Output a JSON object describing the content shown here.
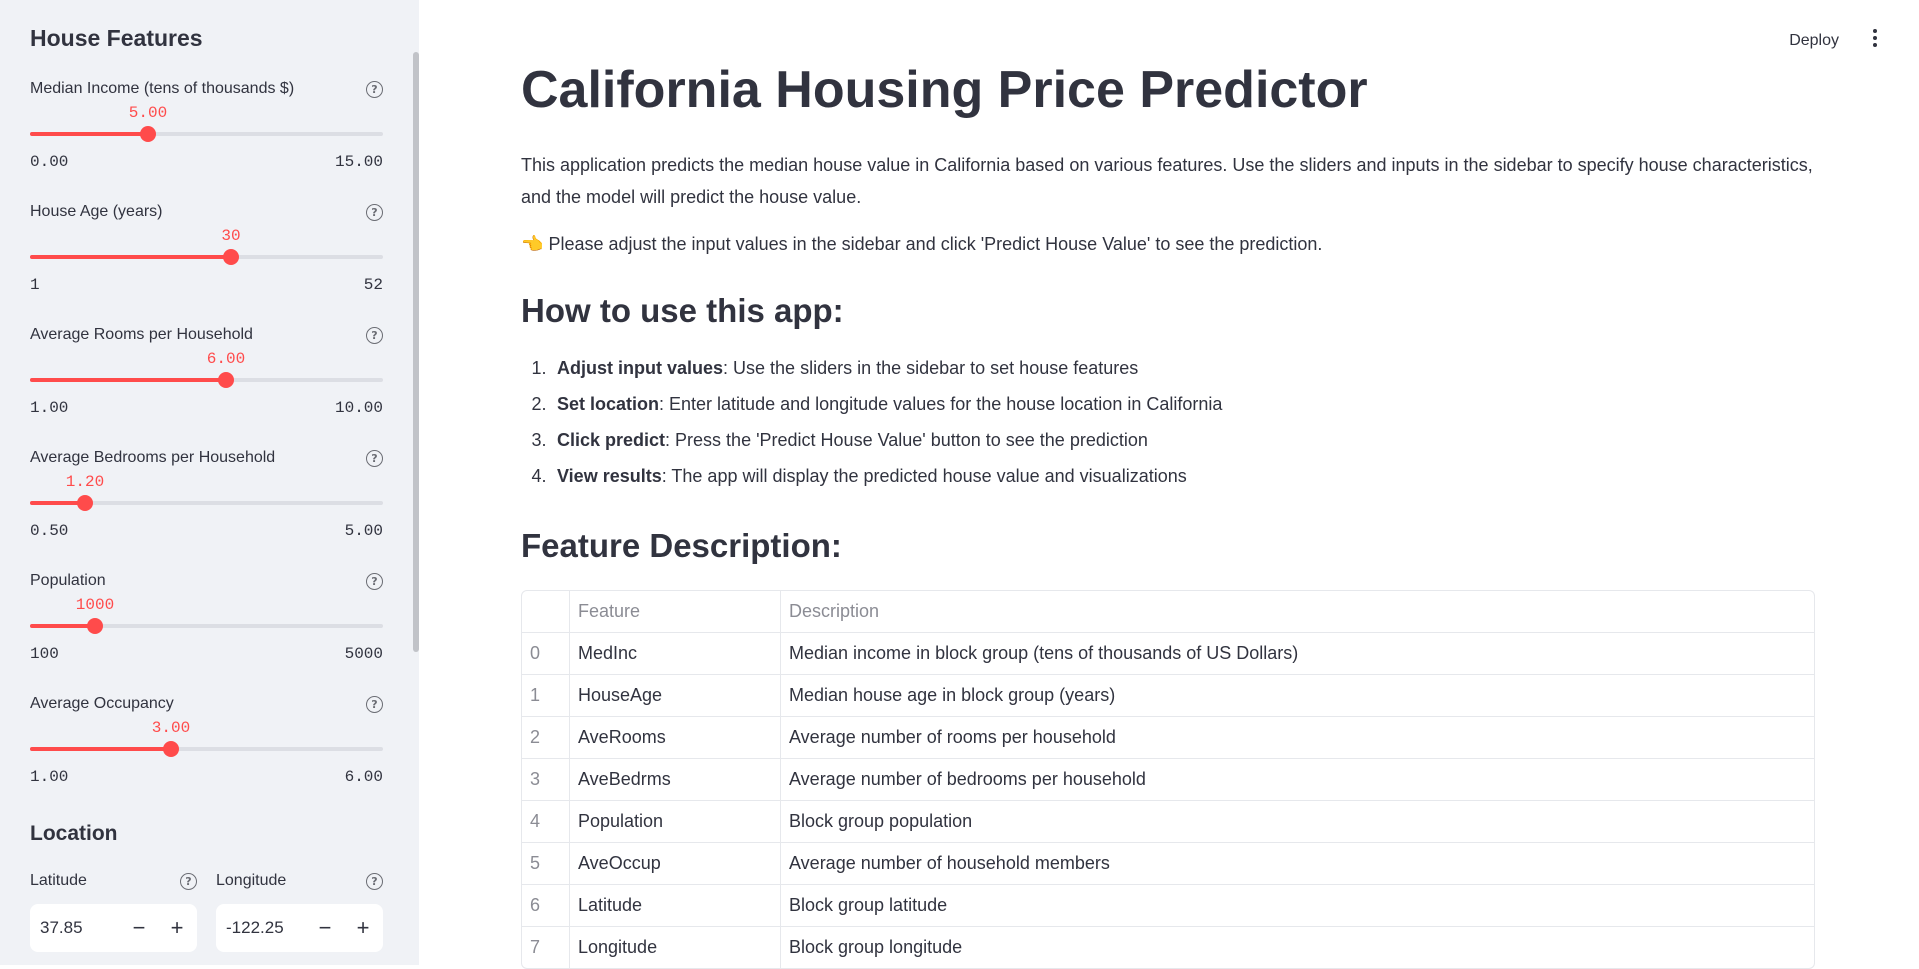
{
  "sidebar": {
    "title": "House Features",
    "help_glyph": "?",
    "sliders": [
      {
        "label": "Median Income (tens of thousands $)",
        "value": "5.00",
        "min": "0.00",
        "max": "15.00",
        "level": 0.3333
      },
      {
        "label": "House Age (years)",
        "value": "30",
        "min": "1",
        "max": "52",
        "level": 0.5686
      },
      {
        "label": "Average Rooms per Household",
        "value": "6.00",
        "min": "1.00",
        "max": "10.00",
        "level": 0.5556
      },
      {
        "label": "Average Bedrooms per Household",
        "value": "1.20",
        "min": "0.50",
        "max": "5.00",
        "level": 0.1556
      },
      {
        "label": "Population",
        "value": "1000",
        "min": "100",
        "max": "5000",
        "level": 0.1837
      },
      {
        "label": "Average Occupancy",
        "value": "3.00",
        "min": "1.00",
        "max": "6.00",
        "level": 0.4
      }
    ],
    "location": {
      "title": "Location",
      "latitude": {
        "label": "Latitude",
        "value": "37.85"
      },
      "longitude": {
        "label": "Longitude",
        "value": "-122.25"
      },
      "minus": "−",
      "plus": "+"
    }
  },
  "header": {
    "deploy_label": "Deploy",
    "menu_icon": "kebab-menu-icon"
  },
  "main": {
    "title": "California Housing Price Predictor",
    "intro": "This application predicts the median house value in California based on various features. Use the sliders and inputs in the sidebar to specify house characteristics, and the model will predict the house value.",
    "hint_emoji": "👈",
    "hint": "Please adjust the input values in the sidebar and click 'Predict House Value' to see the prediction.",
    "how_title": "How to use this app:",
    "steps": [
      {
        "num": "1.",
        "bold": "Adjust input values",
        "text": ": Use the sliders in the sidebar to set house features"
      },
      {
        "num": "2.",
        "bold": "Set location",
        "text": ": Enter latitude and longitude values for the house location in California"
      },
      {
        "num": "3.",
        "bold": "Click predict",
        "text": ": Press the 'Predict House Value' button to see the prediction"
      },
      {
        "num": "4.",
        "bold": "View results",
        "text": ": The app will display the predicted house value and visualizations"
      }
    ],
    "feature_title": "Feature Description:",
    "table": {
      "headers": [
        "",
        "Feature",
        "Description"
      ],
      "rows": [
        [
          "0",
          "MedInc",
          "Median income in block group (tens of thousands of US Dollars)"
        ],
        [
          "1",
          "HouseAge",
          "Median house age in block group (years)"
        ],
        [
          "2",
          "AveRooms",
          "Average number of rooms per household"
        ],
        [
          "3",
          "AveBedrms",
          "Average number of bedrooms per household"
        ],
        [
          "4",
          "Population",
          "Block group population"
        ],
        [
          "5",
          "AveOccup",
          "Average number of household members"
        ],
        [
          "6",
          "Latitude",
          "Block group latitude"
        ],
        [
          "7",
          "Longitude",
          "Block group longitude"
        ]
      ]
    }
  },
  "colors": {
    "accent": "#ff4b4b",
    "sidebar_bg": "#f0f2f6",
    "text": "#31333f"
  }
}
